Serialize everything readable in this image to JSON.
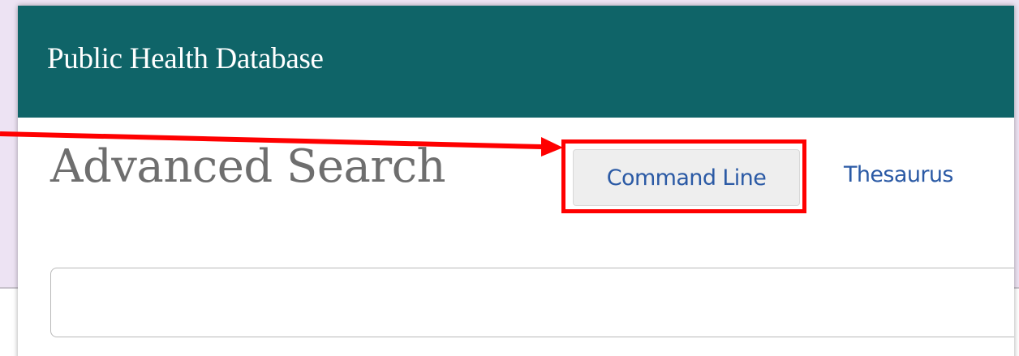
{
  "header": {
    "title": "Public Health Database",
    "background_color": "#0f6468"
  },
  "page": {
    "title": "Advanced Search"
  },
  "actions": {
    "command_line_label": "Command Line",
    "thesaurus_label": "Thesaurus"
  },
  "search": {
    "value": "",
    "placeholder": ""
  },
  "annotation": {
    "highlight_color": "#ff0000",
    "target": "command-line-button"
  },
  "colors": {
    "link": "#2b5aa5",
    "page_background": "#ede3f3"
  }
}
